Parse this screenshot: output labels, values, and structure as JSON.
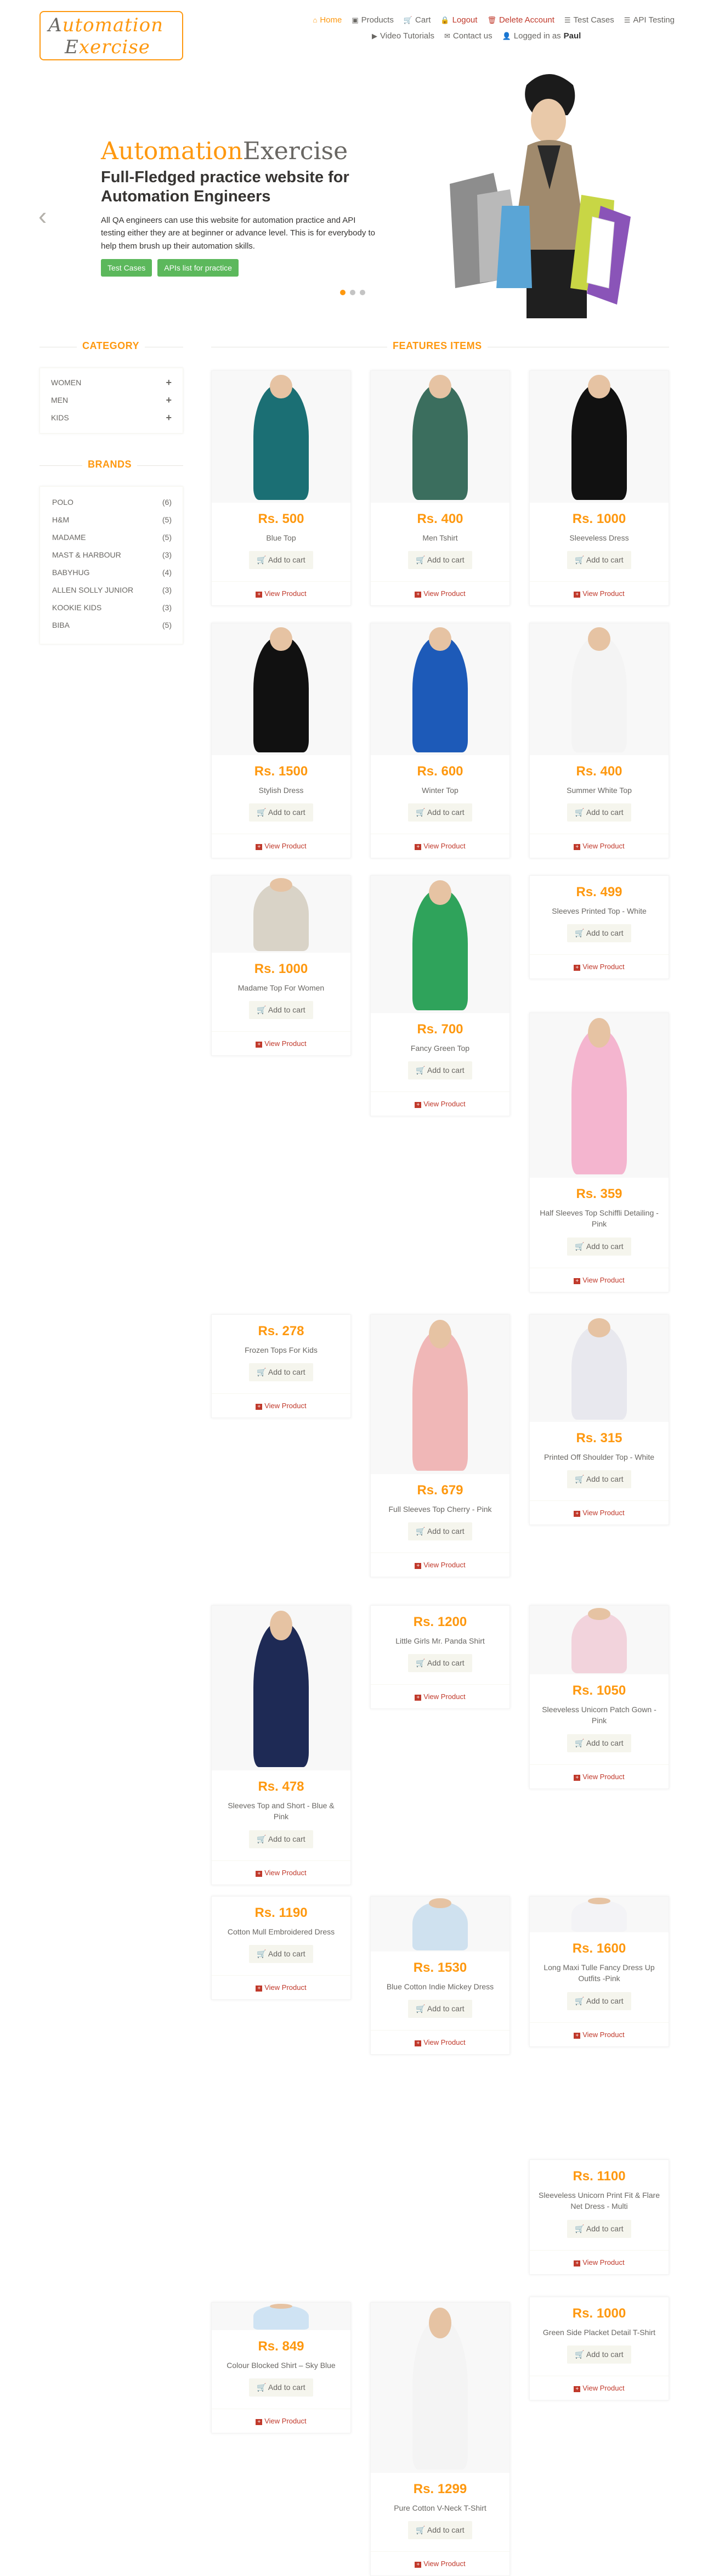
{
  "header": {
    "logo": {
      "line1_first": "A",
      "line1_rest": "utomation",
      "line2_first": "E",
      "line2_rest": "xercise"
    },
    "nav_row1": [
      {
        "label": "Home",
        "icon": "home-icon",
        "glyph": "⌂",
        "active": true
      },
      {
        "label": "Products",
        "icon": "products-icon",
        "glyph": "▣"
      },
      {
        "label": "Cart",
        "icon": "cart-icon",
        "glyph": "🛒"
      },
      {
        "label": "Logout",
        "icon": "lock-icon",
        "glyph": "🔒",
        "red": true
      },
      {
        "label": "Delete Account",
        "icon": "trash-icon",
        "glyph": "🗑",
        "red": true
      },
      {
        "label": "Test Cases",
        "icon": "list-icon",
        "glyph": "☰"
      },
      {
        "label": "API Testing",
        "icon": "list-icon",
        "glyph": "☰"
      }
    ],
    "nav_row2": [
      {
        "label": "Video Tutorials",
        "icon": "youtube-icon",
        "glyph": "▶"
      },
      {
        "label": "Contact us",
        "icon": "envelope-icon",
        "glyph": "✉"
      },
      {
        "label": "Logged in as",
        "user": "Paul",
        "icon": "user-icon",
        "glyph": "👤"
      }
    ]
  },
  "slider": {
    "title_part1": "Automation",
    "title_part2": "Exercise",
    "subtitle": "Full-Fledged practice website for Automation Engineers",
    "description": "All QA engineers can use this website for automation practice and API testing either they are at beginner or advance level. This is for everybody to help them brush up their automation skills.",
    "btn_test_cases": "Test Cases",
    "btn_apis": "APIs list for practice"
  },
  "sidebar": {
    "category_title": "CATEGORY",
    "categories": [
      "WOMEN",
      "MEN",
      "KIDS"
    ],
    "brands_title": "BRANDS",
    "brands": [
      {
        "name": "POLO",
        "count": "(6)"
      },
      {
        "name": "H&M",
        "count": "(5)"
      },
      {
        "name": "MADAME",
        "count": "(5)"
      },
      {
        "name": "MAST & HARBOUR",
        "count": "(3)"
      },
      {
        "name": "BABYHUG",
        "count": "(4)"
      },
      {
        "name": "ALLEN SOLLY JUNIOR",
        "count": "(3)"
      },
      {
        "name": "KOOKIE KIDS",
        "count": "(3)"
      },
      {
        "name": "BIBA",
        "count": "(5)"
      }
    ]
  },
  "features": {
    "title": "FEATURES ITEMS",
    "add_to_cart": "Add to cart",
    "view_product": "View Product",
    "products": [
      {
        "price": "Rs. 500",
        "name": "Blue Top"
      },
      {
        "price": "Rs. 400",
        "name": "Men Tshirt"
      },
      {
        "price": "Rs. 1000",
        "name": "Sleeveless Dress"
      },
      {
        "price": "Rs. 1500",
        "name": "Stylish Dress"
      },
      {
        "price": "Rs. 600",
        "name": "Winter Top"
      },
      {
        "price": "Rs. 400",
        "name": "Summer White Top"
      },
      {
        "price": "Rs. 1000",
        "name": "Madame Top For Women"
      },
      {
        "price": "Rs. 700",
        "name": "Fancy Green Top"
      },
      {
        "price": "Rs. 499",
        "name": "Sleeves Printed Top - White"
      },
      {
        "price": "Rs. 359",
        "name": "Half Sleeves Top Schiffli Detailing - Pink"
      },
      {
        "price": "Rs. 278",
        "name": "Frozen Tops For Kids"
      },
      {
        "price": "Rs. 679",
        "name": "Full Sleeves Top Cherry - Pink"
      },
      {
        "price": "Rs. 315",
        "name": "Printed Off Shoulder Top - White"
      },
      {
        "price": "Rs. 478",
        "name": "Sleeves Top and Short - Blue & Pink"
      },
      {
        "price": "Rs. 1200",
        "name": "Little Girls Mr. Panda Shirt"
      },
      {
        "price": "Rs. 1050",
        "name": "Sleeveless Unicorn Patch Gown - Pink"
      },
      {
        "price": "Rs. 1190",
        "name": "Cotton Mull Embroidered Dress"
      },
      {
        "price": "Rs. 1530",
        "name": "Blue Cotton Indie Mickey Dress"
      },
      {
        "price": "Rs. 1600",
        "name": "Long Maxi Tulle Fancy Dress Up Outfits -Pink"
      },
      {
        "price": "Rs. 1100",
        "name": "Sleeveless Unicorn Print Fit & Flare Net Dress - Multi"
      },
      {
        "price": "Rs. 1000",
        "name": "Green Side Placket Detail T-Shirt"
      },
      {
        "price": "Rs. 849",
        "name": "Colour Blocked Shirt – Sky Blue"
      },
      {
        "price": "Rs. 1299",
        "name": "Pure Cotton V-Neck T-Shirt"
      }
    ]
  }
}
